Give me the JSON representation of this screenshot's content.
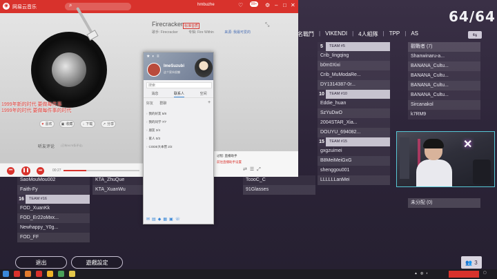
{
  "lobby": {
    "counter": "64/64",
    "tabs": [
      "名戰鬥",
      "VIKENDI",
      "4人組隊",
      "TPP",
      "AS"
    ],
    "team5": {
      "num": "5",
      "label": "TEAM #5",
      "players": [
        "Crib_Iingqing",
        "b0m0Xixi",
        "Crib_MuModaRe...",
        "DY1314387-0r..."
      ]
    },
    "team10": {
      "num": "10",
      "label": "TEAM #10",
      "players": [
        "Eddie_huan",
        "SzYuDwO",
        "2004STAR_Xia...",
        "DOUYU_694082..."
      ]
    },
    "team15": {
      "num": "15",
      "label": "TEAM #15",
      "players": [
        "gxgzuimei",
        "B8MeiMeiGxG",
        "shenggou001",
        "LLLLLLanMei"
      ]
    },
    "team_mid_bottom": [
      "KTA_ZhuQue",
      "KTA_XuanWu"
    ],
    "team_col3_bottom": [
      "TcooC_C",
      "91Glasses"
    ],
    "left_players": [
      "SaoMouMou002",
      "Faith-Fy"
    ],
    "team16": {
      "num": "16",
      "label": "TEAM #16",
      "players": [
        "FOD_XuanKk",
        "FOD_Er22oMxx...",
        "Newhappy_Y0g...",
        "FOD_FF"
      ]
    },
    "spectators": {
      "header": "觀戰者 (7)",
      "list": [
        "Shanwinaru-a...",
        "BANANA_Cultu...",
        "BANANA_Cultu...",
        "BANANA_Cultu...",
        "BANANA_Cultu...",
        "Sircanakol",
        "k7RM9"
      ]
    },
    "unassigned": "未分配 (0)",
    "player_count": "3",
    "exit_button": "退出",
    "settings_button": "遊戲設定",
    "swap_icon": "swap-icon",
    "colors": {
      "accent": "#d8322c",
      "webcam_border": "#57c8d6"
    }
  },
  "music": {
    "app_title": "网易云音乐",
    "user_name": "hmbuzhe",
    "badge": "99+",
    "song_title": "Firecracker",
    "song_tag": "标准音质",
    "artist_label": "歌手: Firecracker",
    "album_label": "专辑: Fire Within",
    "source_label": "来源: 我最可爱的",
    "lyrics_line1": "1999年新的时代 要做每件事",
    "lyrics_line2": "1999年的时代 要做每件事的时代",
    "actions": [
      "喜欢",
      "收藏",
      "下载",
      "分享"
    ],
    "comments_heading": "听友评论",
    "comments_sub": "(已有5678条评论)",
    "time": "00:27"
  },
  "chat": {
    "name": "ImeSuzubi",
    "signature": "这个家伙很懒",
    "search_placeholder": "搜索",
    "tabs": [
      "消息",
      "联系人",
      "空间"
    ],
    "subtabs": [
      "好友",
      "群聊"
    ],
    "groups": [
      "我的好友 5/8",
      "我的同学 7/7",
      "朋友 2/4",
      "家人 0/3",
      "CODE大本营 2/2"
    ]
  },
  "notify": {
    "line1": "过程: 直播助手",
    "line2": "前往直播助手设置"
  }
}
